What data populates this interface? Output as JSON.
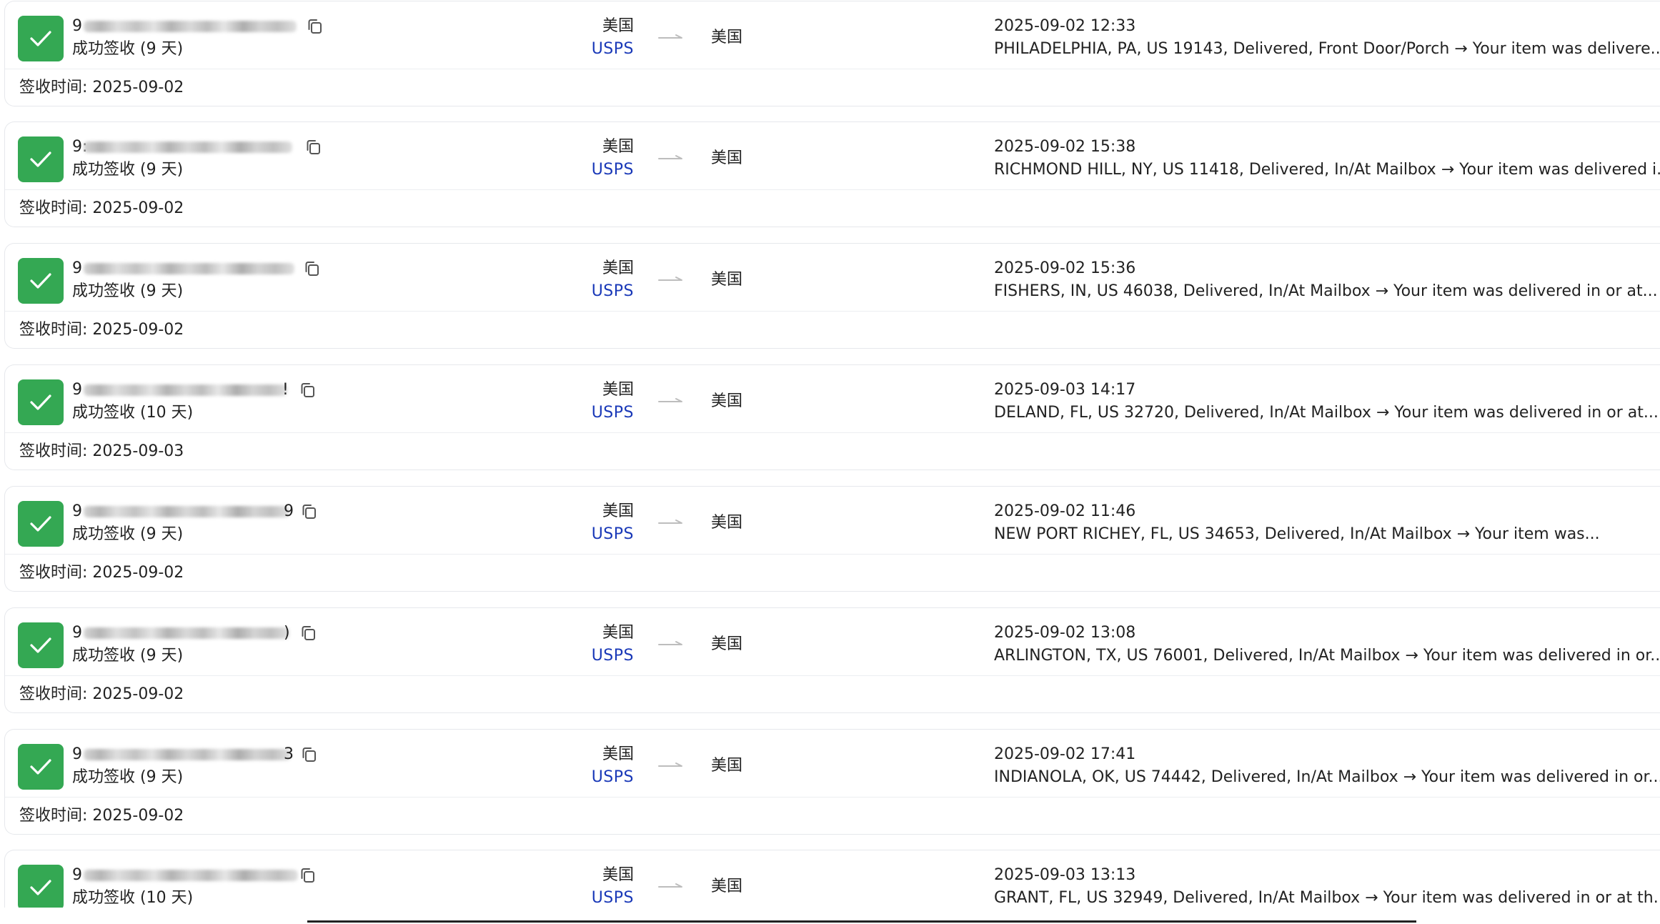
{
  "colors": {
    "success": "#34a853",
    "carrier_link": "#1a39b8"
  },
  "icons": {
    "status": "check-icon",
    "copy": "copy-icon",
    "route": "arrow-right-icon"
  },
  "shipments": [
    {
      "tracking_prefix": "9",
      "tracking_suffix": "",
      "status": "成功签收 (9 天)",
      "origin": "美国",
      "carrier": "USPS",
      "destination": "美国",
      "latest_time": "2025-09-02 12:33",
      "latest_event": "PHILADELPHIA, PA, US 19143, Delivered, Front Door/Porch → Your item was delivere...",
      "received_label": "签收时间: 2025-09-02"
    },
    {
      "tracking_prefix": "9:",
      "tracking_suffix": "",
      "status": "成功签收 (9 天)",
      "origin": "美国",
      "carrier": "USPS",
      "destination": "美国",
      "latest_time": "2025-09-02 15:38",
      "latest_event": "RICHMOND HILL, NY, US 11418, Delivered, In/At Mailbox → Your item was delivered i...",
      "received_label": "签收时间: 2025-09-02"
    },
    {
      "tracking_prefix": "9",
      "tracking_suffix": "",
      "status": "成功签收 (9 天)",
      "origin": "美国",
      "carrier": "USPS",
      "destination": "美国",
      "latest_time": "2025-09-02 15:36",
      "latest_event": "FISHERS, IN, US 46038, Delivered, In/At Mailbox → Your item was delivered in or at...",
      "received_label": "签收时间: 2025-09-02"
    },
    {
      "tracking_prefix": "9",
      "tracking_suffix": "!",
      "status": "成功签收 (10 天)",
      "origin": "美国",
      "carrier": "USPS",
      "destination": "美国",
      "latest_time": "2025-09-03 14:17",
      "latest_event": "DELAND, FL, US 32720, Delivered, In/At Mailbox → Your item was delivered in or at...",
      "received_label": "签收时间: 2025-09-03"
    },
    {
      "tracking_prefix": "9",
      "tracking_suffix": "9",
      "status": "成功签收 (9 天)",
      "origin": "美国",
      "carrier": "USPS",
      "destination": "美国",
      "latest_time": "2025-09-02 11:46",
      "latest_event": "NEW PORT RICHEY, FL, US 34653, Delivered, In/At Mailbox → Your item was...",
      "received_label": "签收时间: 2025-09-02"
    },
    {
      "tracking_prefix": "9",
      "tracking_suffix": ")",
      "status": "成功签收 (9 天)",
      "origin": "美国",
      "carrier": "USPS",
      "destination": "美国",
      "latest_time": "2025-09-02 13:08",
      "latest_event": "ARLINGTON, TX, US 76001, Delivered, In/At Mailbox → Your item was delivered in or...",
      "received_label": "签收时间: 2025-09-02"
    },
    {
      "tracking_prefix": "9",
      "tracking_suffix": "3",
      "status": "成功签收 (9 天)",
      "origin": "美国",
      "carrier": "USPS",
      "destination": "美国",
      "latest_time": "2025-09-02 17:41",
      "latest_event": "INDIANOLA, OK, US 74442, Delivered, In/At Mailbox → Your item was delivered in or...",
      "received_label": "签收时间: 2025-09-02"
    },
    {
      "tracking_prefix": "9",
      "tracking_suffix": "",
      "status": "成功签收 (10 天)",
      "origin": "美国",
      "carrier": "USPS",
      "destination": "美国",
      "latest_time": "2025-09-03 13:13",
      "latest_event": "GRANT, FL, US 32949, Delivered, In/At Mailbox → Your item was delivered in or at th...",
      "received_label": ""
    }
  ]
}
